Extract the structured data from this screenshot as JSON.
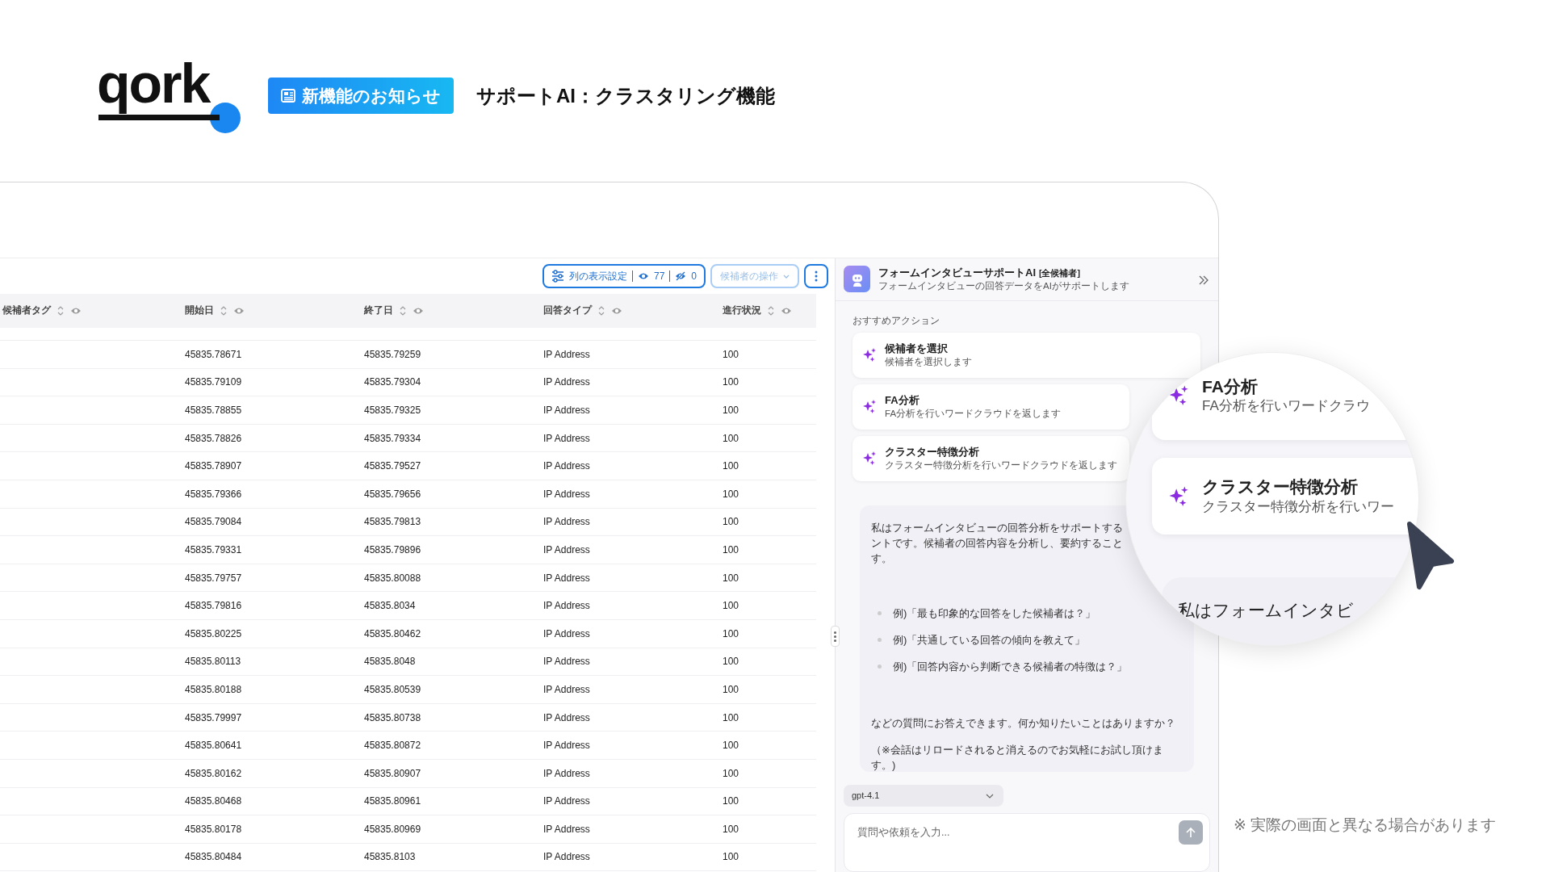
{
  "brand": {
    "logo": "qork",
    "badge": "新機能のお知らせ",
    "headline": "サポートAI：クラスタリング機能"
  },
  "toolbar": {
    "column_settings": {
      "label": "列の表示設定",
      "visible_count": "77",
      "hidden_count": "0"
    },
    "candidate_actions": {
      "label": "候補者の操作",
      "disabled": true
    }
  },
  "table": {
    "columns": [
      "候補者タグ",
      "開始日",
      "終了日",
      "回答タイプ",
      "進行状況"
    ],
    "rows": [
      {
        "start": "45835.78671",
        "end": "45835.79259",
        "type": "IP Address",
        "progress": "100"
      },
      {
        "start": "45835.79109",
        "end": "45835.79304",
        "type": "IP Address",
        "progress": "100"
      },
      {
        "start": "45835.78855",
        "end": "45835.79325",
        "type": "IP Address",
        "progress": "100"
      },
      {
        "start": "45835.78826",
        "end": "45835.79334",
        "type": "IP Address",
        "progress": "100"
      },
      {
        "start": "45835.78907",
        "end": "45835.79527",
        "type": "IP Address",
        "progress": "100"
      },
      {
        "start": "45835.79366",
        "end": "45835.79656",
        "type": "IP Address",
        "progress": "100"
      },
      {
        "start": "45835.79084",
        "end": "45835.79813",
        "type": "IP Address",
        "progress": "100"
      },
      {
        "start": "45835.79331",
        "end": "45835.79896",
        "type": "IP Address",
        "progress": "100"
      },
      {
        "start": "45835.79757",
        "end": "45835.80088",
        "type": "IP Address",
        "progress": "100"
      },
      {
        "start": "45835.79816",
        "end": "45835.8034",
        "type": "IP Address",
        "progress": "100"
      },
      {
        "start": "45835.80225",
        "end": "45835.80462",
        "type": "IP Address",
        "progress": "100"
      },
      {
        "start": "45835.80113",
        "end": "45835.8048",
        "type": "IP Address",
        "progress": "100"
      },
      {
        "start": "45835.80188",
        "end": "45835.80539",
        "type": "IP Address",
        "progress": "100"
      },
      {
        "start": "45835.79997",
        "end": "45835.80738",
        "type": "IP Address",
        "progress": "100"
      },
      {
        "start": "45835.80641",
        "end": "45835.80872",
        "type": "IP Address",
        "progress": "100"
      },
      {
        "start": "45835.80162",
        "end": "45835.80907",
        "type": "IP Address",
        "progress": "100"
      },
      {
        "start": "45835.80468",
        "end": "45835.80961",
        "type": "IP Address",
        "progress": "100"
      },
      {
        "start": "45835.80178",
        "end": "45835.80969",
        "type": "IP Address",
        "progress": "100"
      },
      {
        "start": "45835.80484",
        "end": "45835.8103",
        "type": "IP Address",
        "progress": "100"
      }
    ]
  },
  "assistant": {
    "title": "フォームインタビューサポートAI",
    "scope": "[全候補者]",
    "subtitle": "フォームインタビューの回答データをAIがサポートします",
    "section_label": "おすすめアクション",
    "actions": [
      {
        "title": "候補者を選択",
        "description": "候補者を選択します"
      },
      {
        "title": "FA分析",
        "description": "FA分析を行いワードクラウドを返します"
      },
      {
        "title": "クラスター特徴分析",
        "description": "クラスター特徴分析を行いワードクラウドを返します"
      }
    ],
    "message": {
      "intro_lines": [
        "私はフォームインタビューの回答分析をサポートする",
        "ントです。候補者の回答内容を分析し、要約すること",
        "す。"
      ],
      "examples": [
        "例)「最も印象的な回答をした候補者は？」",
        "例)「共通している回答の傾向を教えて」",
        "例)「回答内容から判断できる候補者の特徴は？」"
      ],
      "closing": "などの質問にお答えできます。何か知りたいことはありますか？",
      "note_lines": [
        "（※会話はリロードされると消えるのでお気軽にお試し頂けま",
        "す。)"
      ]
    },
    "model": "gpt-4.1",
    "input": {
      "placeholder": "質問や依頼を入力..."
    }
  },
  "magnifier": {
    "actions": [
      {
        "title": "FA分析",
        "description": "FA分析を行いワードクラウ"
      },
      {
        "title": "クラスター特徴分析",
        "description": "クラスター特徴分析を行いワー"
      }
    ],
    "message_line": "私はフォームインタビ"
  },
  "disclaimer": "※ 実際の画面と異なる場合があります"
}
